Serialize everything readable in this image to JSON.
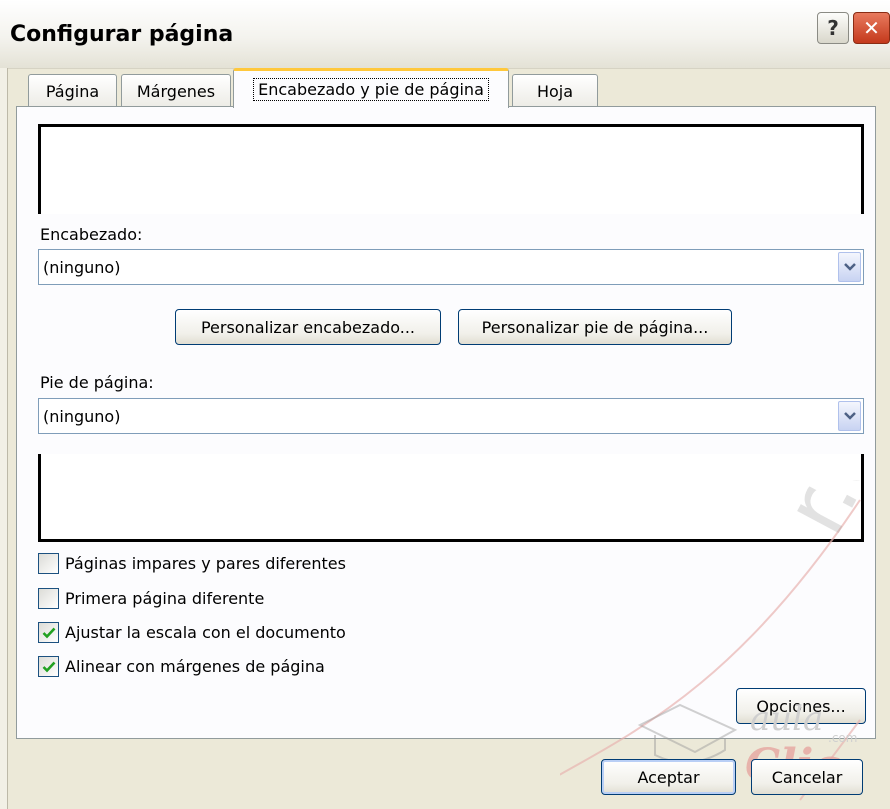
{
  "window": {
    "title": "Configurar página",
    "help_glyph": "?",
    "close_glyph": "✕"
  },
  "tabs": [
    {
      "label": "Página",
      "active": false
    },
    {
      "label": "Márgenes",
      "active": false
    },
    {
      "label": "Encabezado y pie de página",
      "active": true
    },
    {
      "label": "Hoja",
      "active": false
    }
  ],
  "header": {
    "label": "Encabezado:",
    "value": "(ninguno)"
  },
  "custom_buttons": {
    "header": "Personalizar encabezado...",
    "footer": "Personalizar pie de página..."
  },
  "footer": {
    "label": "Pie de página:",
    "value": "(ninguno)"
  },
  "options": [
    {
      "label": "Páginas impares y pares diferentes",
      "checked": false
    },
    {
      "label": "Primera página diferente",
      "checked": false
    },
    {
      "label": "Ajustar la escala con el documento",
      "checked": true
    },
    {
      "label": "Alinear con márgenes de página",
      "checked": true
    }
  ],
  "buttons": {
    "options": "Opciones...",
    "ok": "Aceptar",
    "cancel": "Cancelar"
  },
  "watermark": {
    "brand": "aula",
    "brand2": "Clic",
    "domain": ".com",
    "arc_text": "r.obar"
  },
  "colors": {
    "accent_tab": "#ffc83c",
    "close_button": "#c4391c",
    "check": "#21a121",
    "watermark": "#d9534f"
  },
  "icons": {
    "dropdown": "chevron-down-icon",
    "check": "checkmark-icon"
  }
}
